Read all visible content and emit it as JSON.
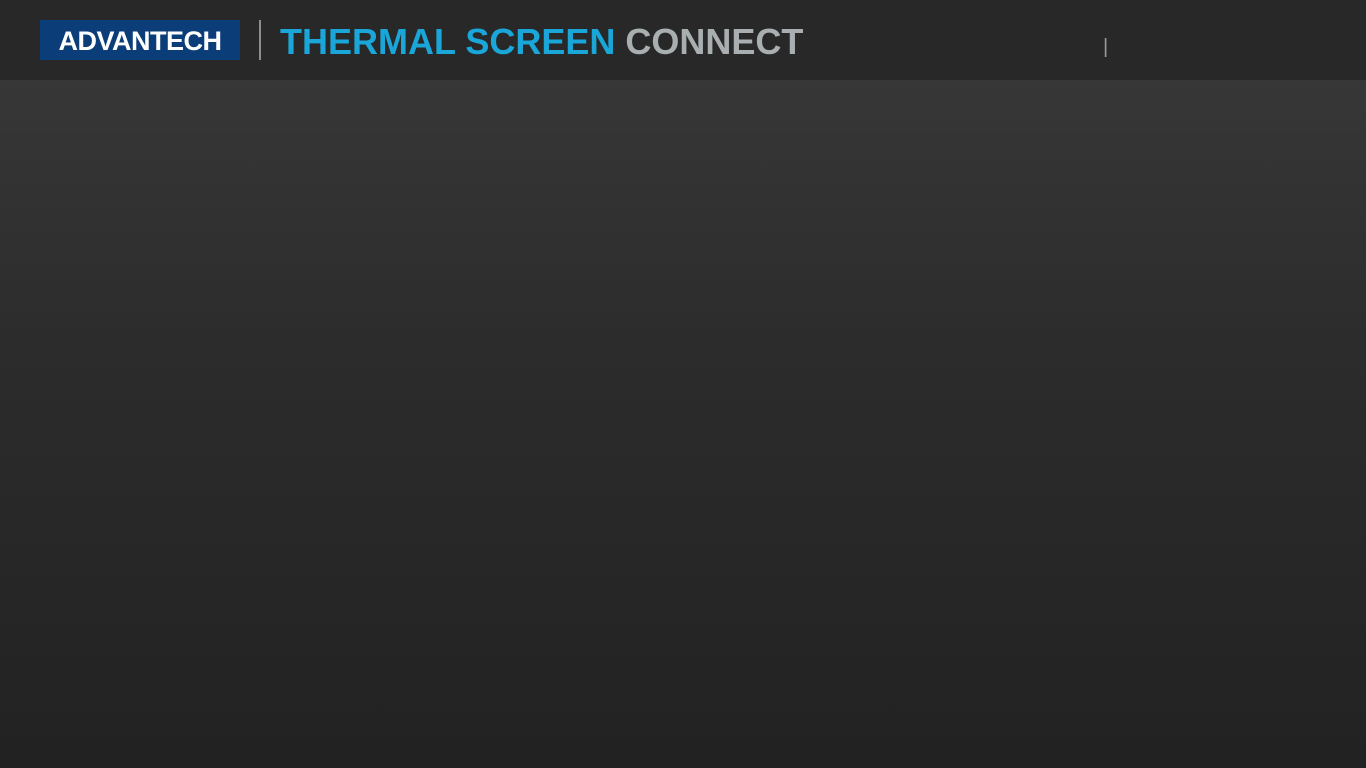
{
  "header": {
    "logo_text": "ADVANTECH",
    "title_part1": "THERMAL SCREEN",
    "title_part2": "CONNECT",
    "separator": "|"
  },
  "colors": {
    "logo_background": "#0b3d78",
    "title_accent": "#1aa6d8",
    "title_muted": "#a9aeb1",
    "header_background": "#282828",
    "page_background_top": "#3a3a3a",
    "page_background_bottom": "#222222"
  }
}
